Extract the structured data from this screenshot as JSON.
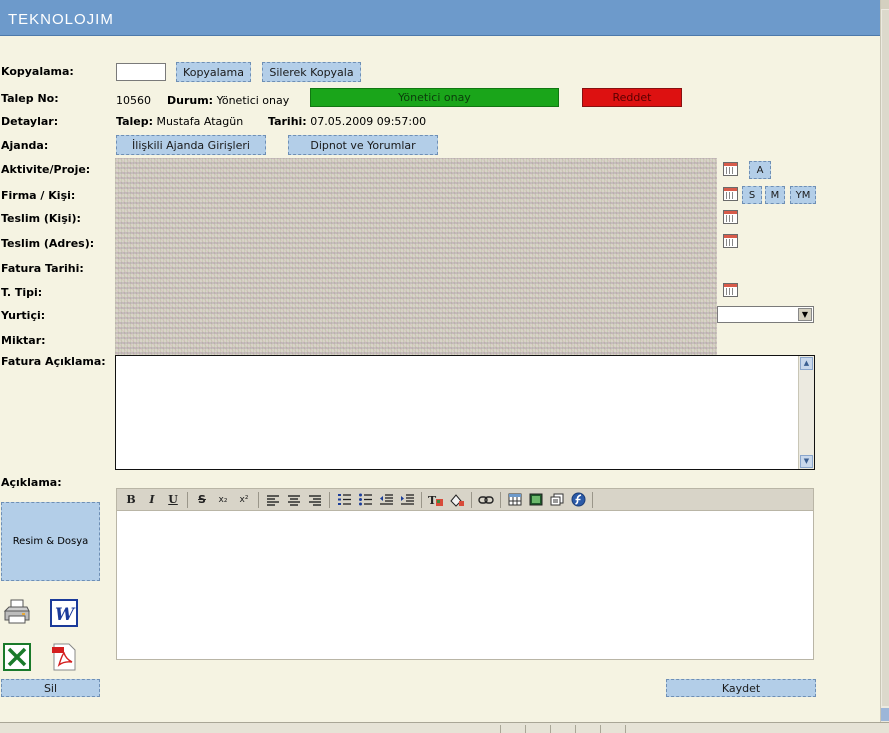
{
  "app": {
    "logo": "TEKNOLOJIM"
  },
  "labels": {
    "kopyalama": "Kopyalama:",
    "talep_no": "Talep No:",
    "detaylar": "Detaylar:",
    "ajanda": "Ajanda:",
    "aktivite": "Aktivite/Proje:",
    "firma": "Firma / Kişi:",
    "teslim_kisi": "Teslim (Kişi):",
    "teslim_adres": "Teslim (Adres):",
    "fatura_tarihi": "Fatura Tarihi:",
    "t_tipi": "T. Tipi:",
    "yurtici": "Yurtiçi:",
    "miktar": "Miktar:",
    "fatura_aciklama": "Fatura Açıklama:",
    "aciklama": "Açıklama:"
  },
  "buttons": {
    "kopyalama": "Kopyalama",
    "silerek_kopyala": "Silerek Kopyala",
    "yonetici_onay": "Yönetici onay",
    "reddet": "Reddet",
    "iliskili_ajanda": "İlişkili Ajanda Girişleri",
    "dipnot": "Dipnot ve Yorumlar",
    "a": "A",
    "s": "S",
    "m": "M",
    "ym": "YM",
    "resim_dosya": "Resim & Dosya",
    "sil": "Sil",
    "kaydet": "Kaydet"
  },
  "talep": {
    "no": "10560",
    "durum_label": "Durum:",
    "durum_value": "Yönetici onay",
    "talep_label": "Talep:",
    "talep_value": "Mustafa Atagün",
    "tarihi_label": "Tarihi:",
    "tarihi_value": "07.05.2009 09:57:00"
  },
  "colors": {
    "header": "#6d9acb",
    "approve": "#1aa51a",
    "reject": "#dd1111",
    "button": "#b3cee8",
    "background": "#f5f3e2"
  },
  "toolbar_icons": [
    "bold-icon",
    "italic-icon",
    "underline-icon",
    "strikethrough-icon",
    "subscript-icon",
    "superscript-icon",
    "align-left-icon",
    "align-center-icon",
    "align-right-icon",
    "ordered-list-icon",
    "unordered-list-icon",
    "outdent-icon",
    "indent-icon",
    "text-color-icon",
    "background-color-icon",
    "link-icon",
    "table-icon",
    "image-icon",
    "template-icon",
    "flash-icon"
  ],
  "toolbar_glyphs": {
    "bold": "B",
    "italic": "I",
    "underline": "U",
    "strike": "S",
    "sub": "x₂",
    "sup": "x²"
  }
}
